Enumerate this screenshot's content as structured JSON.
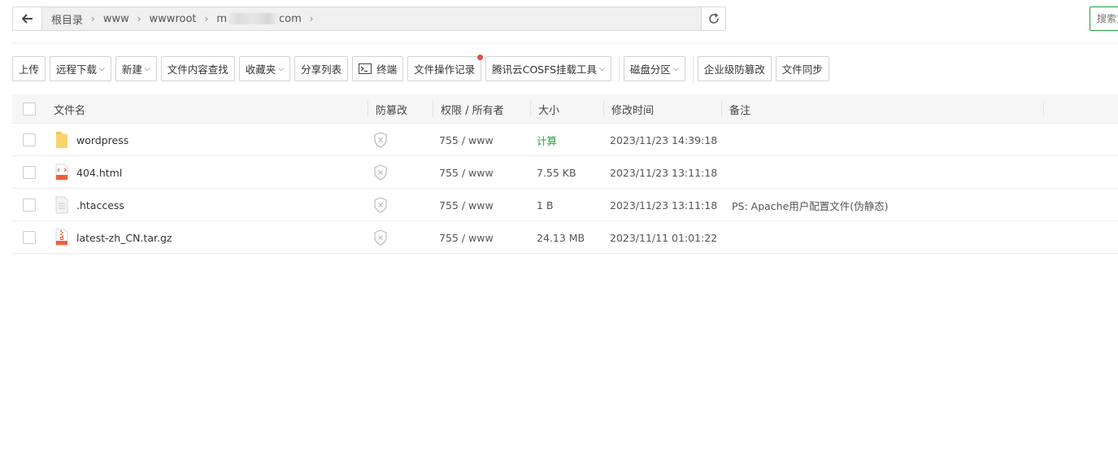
{
  "pathbar": {
    "breadcrumbs": [
      "根目录",
      "www",
      "wwwroot",
      "m",
      "com"
    ]
  },
  "search": {
    "placeholder": "搜索文"
  },
  "toolbar": {
    "upload": "上传",
    "remote_download": "远程下载",
    "new": "新建",
    "content_search": "文件内容查找",
    "favorites": "收藏夹",
    "share_list": "分享列表",
    "terminal": "终端",
    "file_log": "文件操作记录",
    "cosfs": "腾讯云COSFS挂载工具",
    "disk": "磁盘分区",
    "tamper": "企业级防篡改",
    "sync": "文件同步"
  },
  "table": {
    "headers": {
      "name": "文件名",
      "tamper": "防篡改",
      "perm": "权限 / 所有者",
      "size": "大小",
      "mtime": "修改时间",
      "note": "备注"
    },
    "rows": [
      {
        "icon": "folder-icon",
        "name": "wordpress",
        "perm": "755 / www",
        "size": "计算",
        "mtime": "2023/11/23 14:39:18",
        "note": ""
      },
      {
        "icon": "html-file-icon",
        "name": "404.html",
        "perm": "755 / www",
        "size": "7.55 KB",
        "mtime": "2023/11/23 13:11:18",
        "note": ""
      },
      {
        "icon": "text-file-icon",
        "name": ".htaccess",
        "perm": "755 / www",
        "size": "1 B",
        "mtime": "2023/11/23 13:11:18",
        "note": "PS: Apache用户配置文件(伪静态)"
      },
      {
        "icon": "archive-file-icon",
        "name": "latest-zh_CN.tar.gz",
        "perm": "755 / www",
        "size": "24.13 MB",
        "mtime": "2023/11/11 01:01:22",
        "note": ""
      }
    ]
  },
  "colors": {
    "accent": "#20a53a",
    "notify_dot": "#f04848"
  }
}
